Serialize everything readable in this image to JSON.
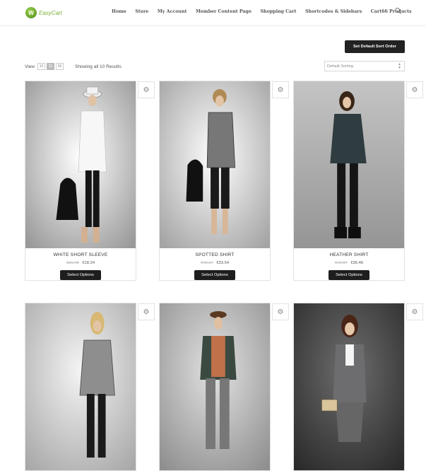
{
  "header": {
    "logo_badge": "W",
    "logo_text": "EasyCart",
    "nav": [
      "Home",
      "Store",
      "My Account",
      "Member Content Page",
      "Shopping Cart",
      "Shortcodes & Sidebars",
      "Cart66 Products"
    ]
  },
  "toolbar": {
    "sort_button": "Set Default Sort Order",
    "view_label": "View",
    "pages": [
      "10",
      "25",
      "50"
    ],
    "showing": "Showing all 10 Results",
    "sort_select": "Default Sorting"
  },
  "products": [
    {
      "name": "WHITE SHORT SLEEVE",
      "old_price": "€20.48",
      "price": "€18.24",
      "button": "Select Options"
    },
    {
      "name": "SPOTTED SHIRT",
      "old_price": "€40.14",
      "price": "€33.54",
      "button": "Select Options"
    },
    {
      "name": "HEATHER SHIRT",
      "old_price": "€40.84",
      "price": "€36.46",
      "button": "Select Options"
    },
    {
      "name": "",
      "old_price": "",
      "price": "",
      "button": ""
    },
    {
      "name": "",
      "old_price": "",
      "price": "",
      "button": ""
    },
    {
      "name": "",
      "old_price": "",
      "price": "",
      "button": ""
    }
  ]
}
